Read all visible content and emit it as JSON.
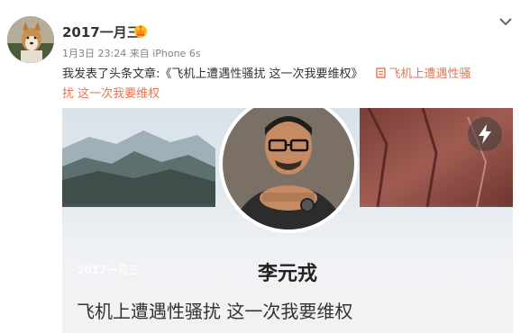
{
  "post": {
    "username": "2017一月三",
    "meta_time": "1月3日 23:24",
    "meta_source": "来自 iPhone 6s",
    "text_prefix": "我发表了头条文章:《飞机上遭遇性骚扰 这一次我要维权》",
    "link_text": "飞机上遭遇性骚",
    "link_text_cont": "扰 这一次我要维权"
  },
  "card": {
    "date_watermark": "2017一月三",
    "author_name": "李元戎",
    "title": "飞机上遭遇性骚扰 这一次我要维权"
  },
  "icons": {
    "vip": "crown-icon",
    "menu": "chevron-down-icon",
    "article": "document-icon",
    "lightning": "lightning-icon"
  },
  "colors": {
    "link": "#eb7350",
    "card_bg": "#f2f2f5"
  }
}
